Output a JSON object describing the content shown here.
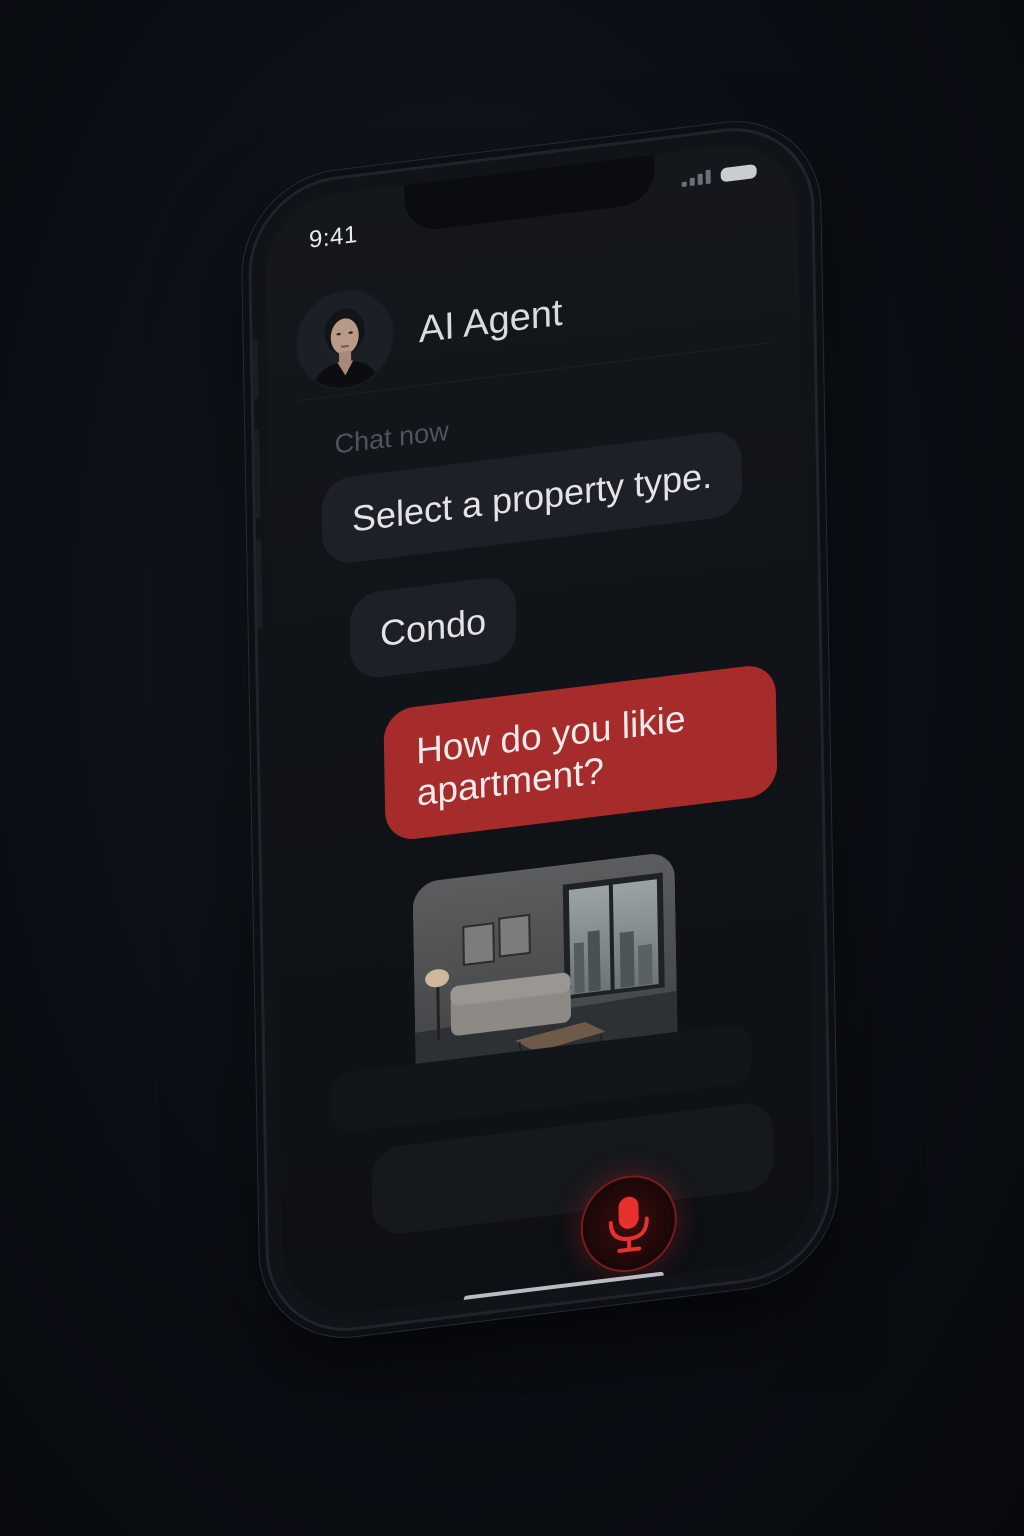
{
  "status_bar": {
    "time": "9:41",
    "signal_icon": "signal-icon",
    "battery_icon": "battery-icon"
  },
  "header": {
    "agent_name": "AI Agent",
    "avatar_icon": "avatar"
  },
  "chat": {
    "section_label": "Chat now",
    "messages": [
      {
        "sender": "agent",
        "text": "Select a property type."
      },
      {
        "sender": "user",
        "text": "Condo"
      },
      {
        "sender": "agent",
        "text": "How do you likie apartment?"
      }
    ],
    "photo": "apartment-living-room-photo",
    "typing_indicator": "typing-dots"
  },
  "input": {
    "mic_icon": "microphone-icon"
  },
  "colors": {
    "accent_red": "#a62b2b",
    "mic_red": "#e8302c",
    "background": "#0b0f15"
  }
}
